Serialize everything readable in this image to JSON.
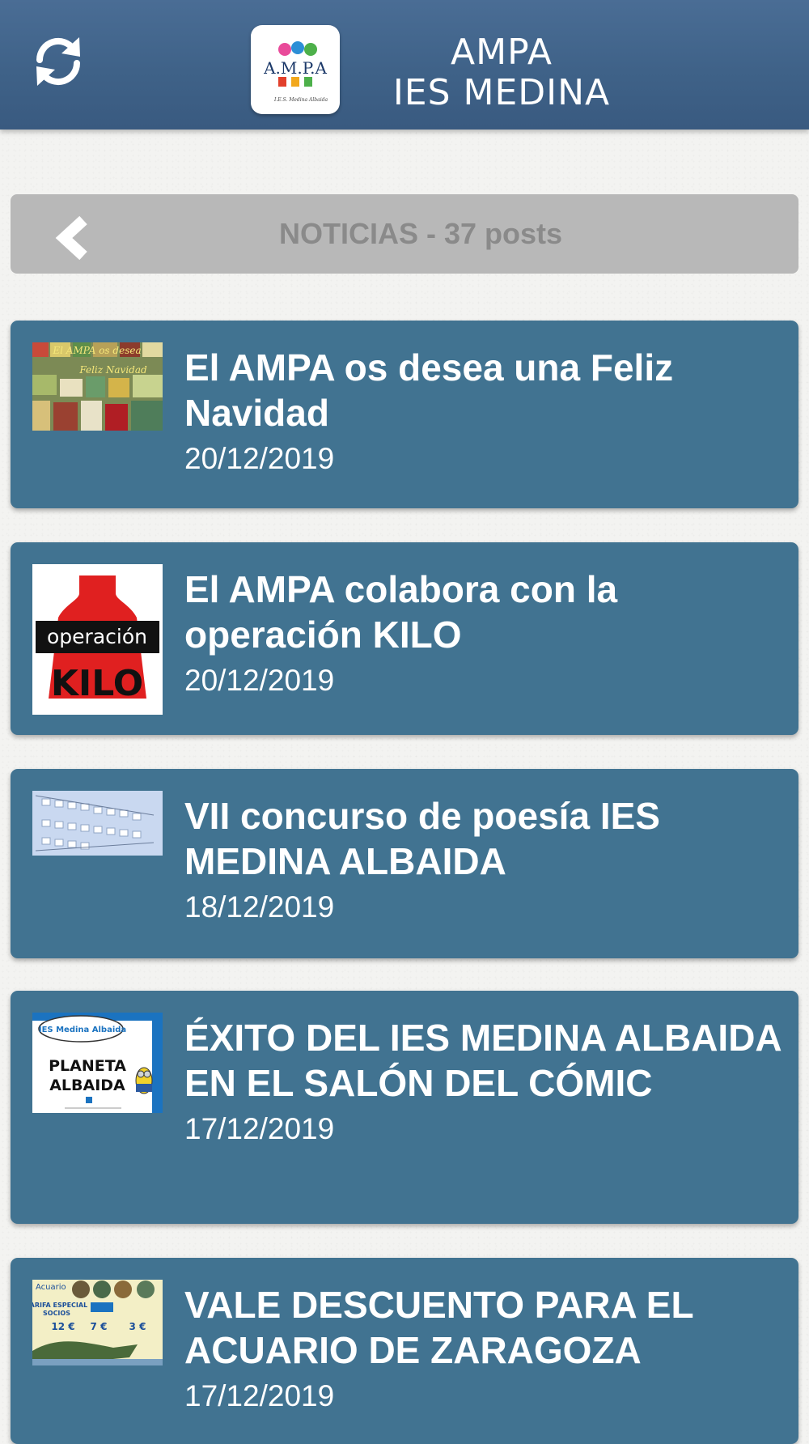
{
  "header": {
    "title_line1": "AMPA",
    "title_line2": "IES MEDINA",
    "refresh_icon": "refresh-icon",
    "logo_text": "A.M.P.A",
    "logo_subtext": "I.E.S. Medina Albaida"
  },
  "section": {
    "title": "NOTICIAS - 37 posts",
    "back_icon": "chevron-left-icon"
  },
  "news": [
    {
      "title": "El AMPA os desea una Feliz Navidad",
      "date": "20/12/2019",
      "thumb_text": [
        "El AMPA os desea",
        "Feliz Navidad"
      ]
    },
    {
      "title": "El AMPA colabora con la operación KILO",
      "date": "20/12/2019",
      "thumb_text": [
        "operación",
        "KILO"
      ]
    },
    {
      "title": "VII concurso de poesía IES MEDINA ALBAIDA",
      "date": "18/12/2019"
    },
    {
      "title": "ÉXITO DEL IES MEDINA ALBAIDA EN EL SALÓN DEL CÓMIC",
      "date": "17/12/2019",
      "thumb_text": [
        "IES Medina Albaida",
        "PLANETA",
        "ALBAIDA"
      ]
    },
    {
      "title": "VALE DESCUENTO PARA EL ACUARIO DE ZARAGOZA",
      "date": "17/12/2019",
      "thumb_text": [
        "Acuario",
        "TARIFA ESPECIAL",
        "SOCIOS",
        "12 €",
        "7 €",
        "3 €"
      ]
    }
  ],
  "colors": {
    "header_bg": "#3f6288",
    "card_bg": "#417391",
    "section_bar_bg": "#b8b8b8",
    "section_text": "#8a8a8a",
    "page_bg": "#f3f3f1"
  }
}
